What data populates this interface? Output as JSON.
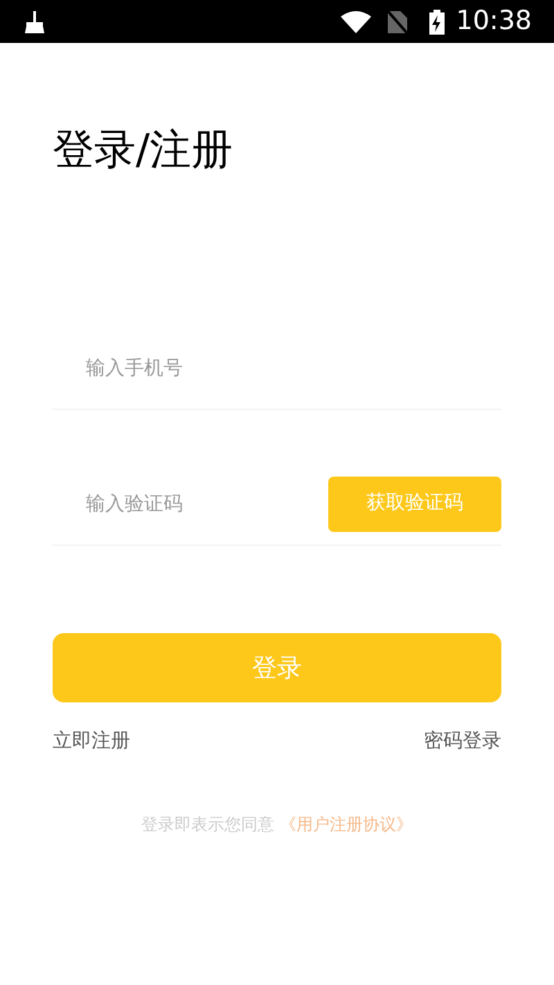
{
  "status_bar": {
    "time": "10:38"
  },
  "title": "登录/注册",
  "phone_field": {
    "placeholder": "输入手机号"
  },
  "code_field": {
    "placeholder": "输入验证码"
  },
  "get_code_button": "获取验证码",
  "login_button": "登录",
  "register_link": "立即注册",
  "password_login_link": "密码登录",
  "agreement": {
    "text": "登录即表示您同意",
    "link": "《用户注册协议》"
  }
}
